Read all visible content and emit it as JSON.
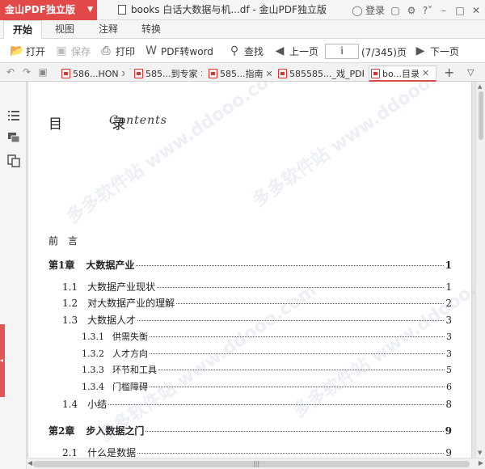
{
  "app": {
    "brand": "金山PDF独立版",
    "doc_title": "books 白话大数据与机...df - 金山PDF独立版",
    "login": "登录"
  },
  "menu_tabs": [
    "开始",
    "视图",
    "注释",
    "转换"
  ],
  "toolbar": {
    "open": "打开",
    "save": "保存",
    "print": "打印",
    "pdf_to_word": "PDF转word",
    "find": "查找",
    "prev_page": "上一页",
    "page_value": "i",
    "page_total": "(7/345)页",
    "next_page": "下一页"
  },
  "doc_tabs": [
    {
      "label": "586...HON",
      "active": false
    },
    {
      "label": "585...到专家",
      "active": false
    },
    {
      "label": "585...指南",
      "active": false
    },
    {
      "label": "585585..._戏_PDF",
      "active": false
    },
    {
      "label": "bo...目录",
      "active": true
    }
  ],
  "document": {
    "heading": "目  录",
    "heading_script": "Contents",
    "toc": [
      {
        "num": "前　言",
        "title": "",
        "page": "",
        "level": 0
      },
      {
        "num": "第1章",
        "title": "大数据产业",
        "page": "1",
        "level": 0
      },
      {
        "num": "1.1",
        "title": "大数据产业现状",
        "page": "1",
        "level": 1
      },
      {
        "num": "1.2",
        "title": "对大数据产业的理解",
        "page": "2",
        "level": 1
      },
      {
        "num": "1.3",
        "title": "大数据人才",
        "page": "3",
        "level": 1
      },
      {
        "num": "1.3.1",
        "title": "供需失衡",
        "page": "3",
        "level": 2
      },
      {
        "num": "1.3.2",
        "title": "人才方向",
        "page": "3",
        "level": 2
      },
      {
        "num": "1.3.3",
        "title": "环节和工具",
        "page": "5",
        "level": 2
      },
      {
        "num": "1.3.4",
        "title": "门槛障碍",
        "page": "6",
        "level": 2
      },
      {
        "num": "1.4",
        "title": "小结",
        "page": "8",
        "level": 1
      },
      {
        "num": "第2章",
        "title": "步入数据之门",
        "page": "9",
        "level": 0
      },
      {
        "num": "2.1",
        "title": "什么是数据",
        "page": "9",
        "level": 1
      }
    ]
  },
  "watermark": "多多软件站 www.ddooo.com",
  "colors": {
    "brand_red": "#e24a4a",
    "active_tab_underline": "#d84b4b"
  }
}
